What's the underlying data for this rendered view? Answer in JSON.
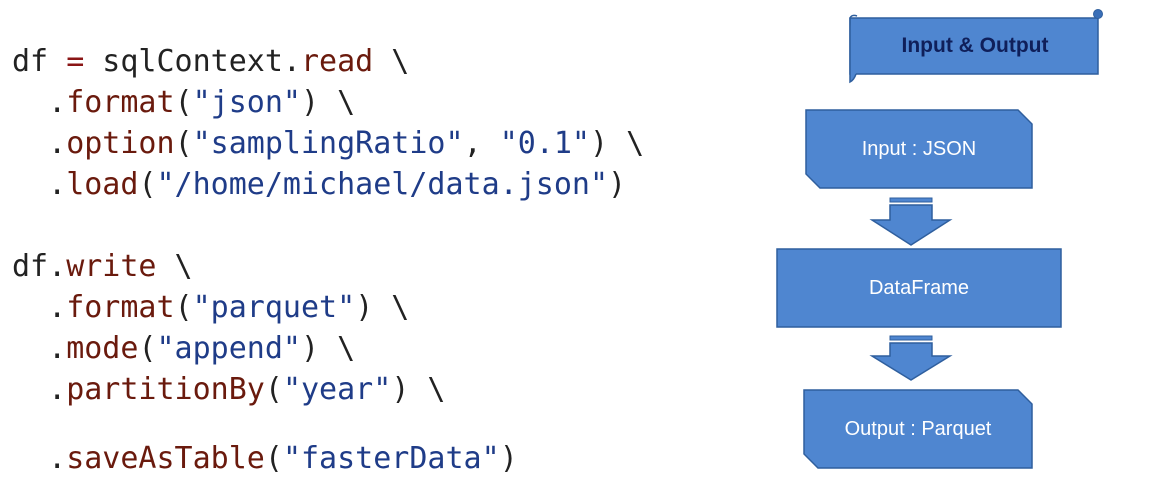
{
  "code": {
    "lines": [
      [
        {
          "t": "df ",
          "k": "plain"
        },
        {
          "t": "=",
          "k": "op"
        },
        {
          "t": " sqlContext.",
          "k": "plain"
        },
        {
          "t": "read",
          "k": "method"
        },
        {
          "t": " \\",
          "k": "plain"
        }
      ],
      [
        {
          "t": "  .",
          "k": "plain"
        },
        {
          "t": "format",
          "k": "method"
        },
        {
          "t": "(",
          "k": "plain"
        },
        {
          "t": "\"json\"",
          "k": "string"
        },
        {
          "t": ") \\",
          "k": "plain"
        }
      ],
      [
        {
          "t": "  .",
          "k": "plain"
        },
        {
          "t": "option",
          "k": "method"
        },
        {
          "t": "(",
          "k": "plain"
        },
        {
          "t": "\"samplingRatio\"",
          "k": "string"
        },
        {
          "t": ", ",
          "k": "plain"
        },
        {
          "t": "\"0.1\"",
          "k": "string"
        },
        {
          "t": ") \\",
          "k": "plain"
        }
      ],
      [
        {
          "t": "  .",
          "k": "plain"
        },
        {
          "t": "load",
          "k": "method"
        },
        {
          "t": "(",
          "k": "plain"
        },
        {
          "t": "\"/home/michael/data.json\"",
          "k": "string"
        },
        {
          "t": ")",
          "k": "plain"
        }
      ],
      [
        {
          "t": "df.",
          "k": "plain"
        },
        {
          "t": "write",
          "k": "method"
        },
        {
          "t": " \\",
          "k": "plain"
        }
      ],
      [
        {
          "t": "  .",
          "k": "plain"
        },
        {
          "t": "format",
          "k": "method"
        },
        {
          "t": "(",
          "k": "plain"
        },
        {
          "t": "\"parquet\"",
          "k": "string"
        },
        {
          "t": ") \\",
          "k": "plain"
        }
      ],
      [
        {
          "t": "  .",
          "k": "plain"
        },
        {
          "t": "mode",
          "k": "method"
        },
        {
          "t": "(",
          "k": "plain"
        },
        {
          "t": "\"append\"",
          "k": "string"
        },
        {
          "t": ") \\",
          "k": "plain"
        }
      ],
      [
        {
          "t": "  .",
          "k": "plain"
        },
        {
          "t": "partitionBy",
          "k": "method"
        },
        {
          "t": "(",
          "k": "plain"
        },
        {
          "t": "\"year\"",
          "k": "string"
        },
        {
          "t": ") \\",
          "k": "plain"
        }
      ],
      [
        {
          "t": "  .",
          "k": "plain"
        },
        {
          "t": "saveAsTable",
          "k": "method"
        },
        {
          "t": "(",
          "k": "plain"
        },
        {
          "t": "\"fasterData\"",
          "k": "string"
        },
        {
          "t": ")",
          "k": "plain"
        }
      ]
    ]
  },
  "diagram": {
    "title": "Input & Output",
    "input": "Input : JSON",
    "middle": "DataFrame",
    "output": "Output : Parquet"
  },
  "colors": {
    "shape_fill": "#4f86d0",
    "shape_stroke": "#2f5f9e",
    "banner_text": "#0f1f5a",
    "code_method": "#6a1a0d",
    "code_string": "#1f3c88",
    "code_op": "#8a1515",
    "code_plain": "#222222"
  }
}
